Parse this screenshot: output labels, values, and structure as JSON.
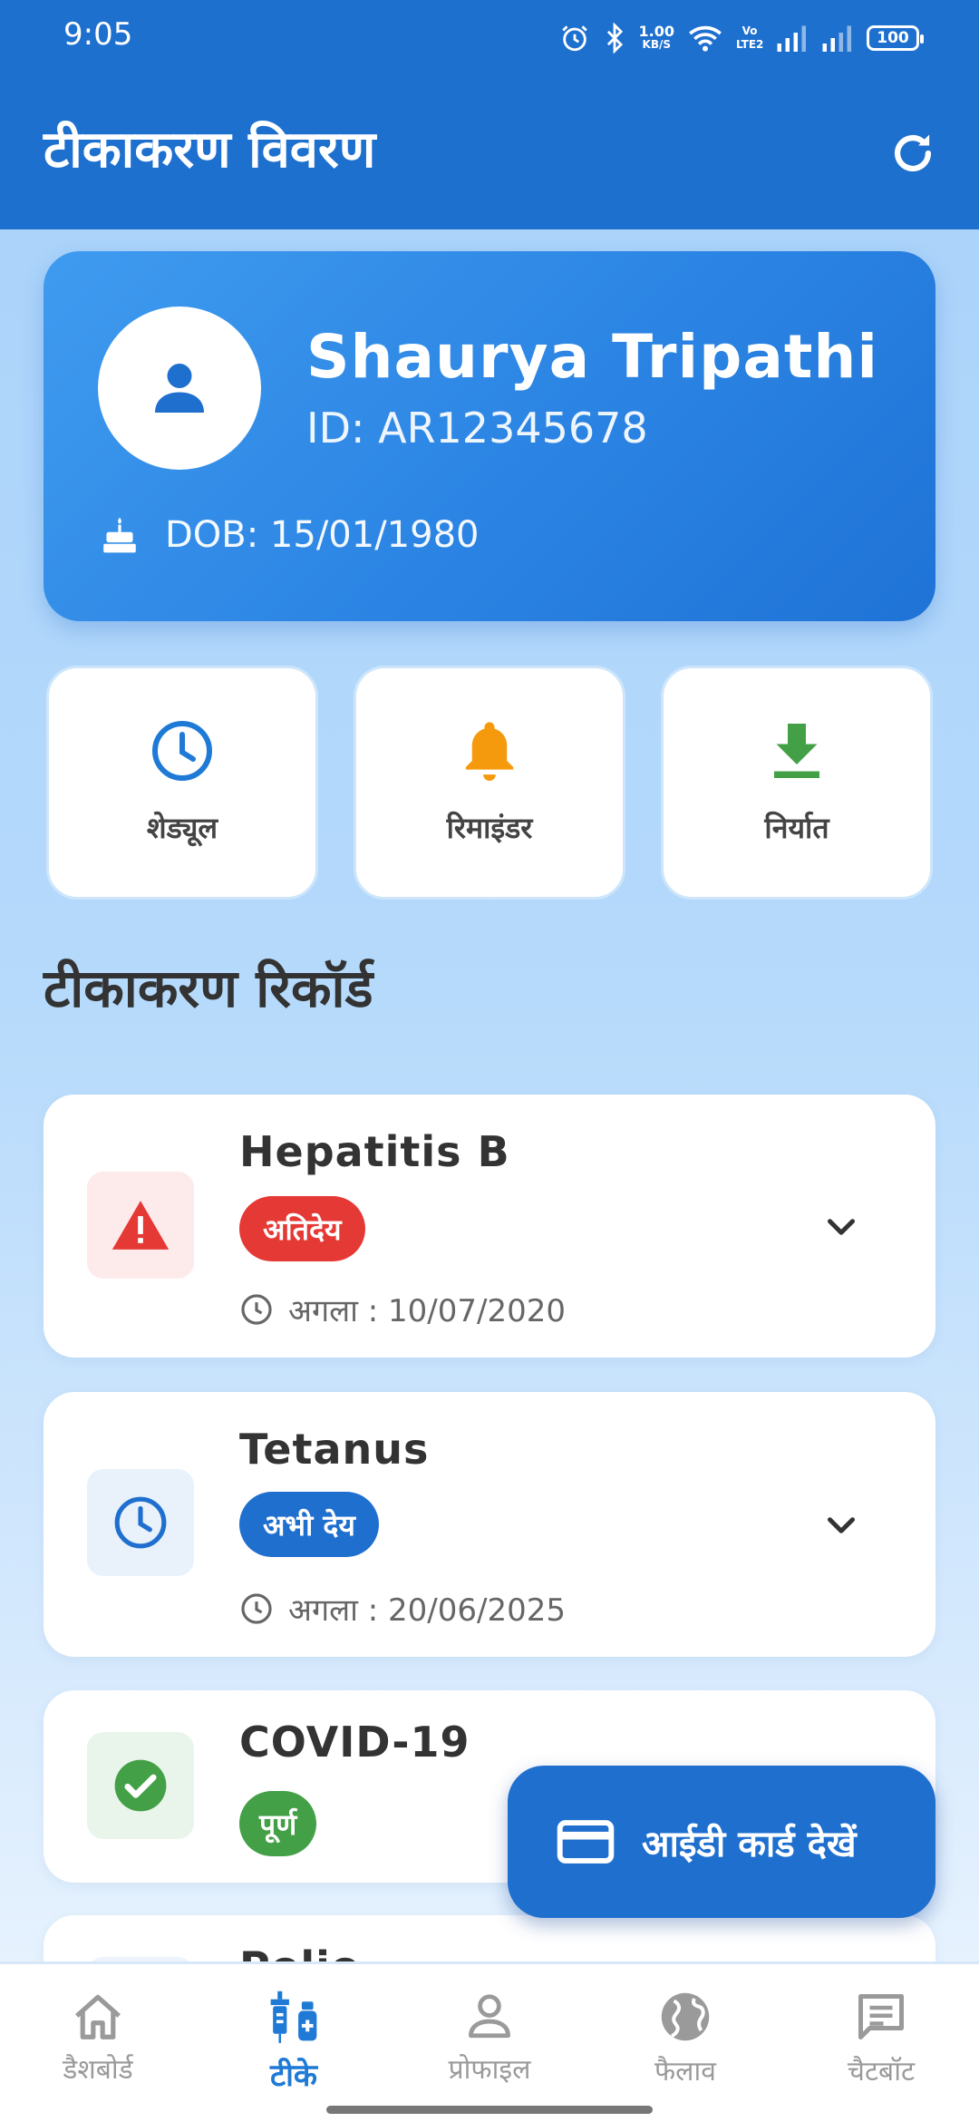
{
  "status_bar": {
    "time": "9:05",
    "network_speed_value": "1.00",
    "network_speed_unit": "KB/S",
    "volte_label": "Vo LTE2",
    "battery": "100"
  },
  "header": {
    "title": "टीकाकरण विवरण",
    "refresh_icon": "refresh-icon"
  },
  "profile": {
    "name": "Shaurya Tripathi",
    "id_text": "ID: AR12345678",
    "dob_text": "DOB: 15/01/1980"
  },
  "actions": [
    {
      "label": "शेड्यूल",
      "icon": "clock-icon",
      "color": "#1f7ad6"
    },
    {
      "label": "रिमाइंडर",
      "icon": "bell-icon",
      "color": "#f59a0c"
    },
    {
      "label": "निर्यात",
      "icon": "download-icon",
      "color": "#43a047"
    }
  ],
  "section_title": "टीकाकरण रिकॉर्ड",
  "vaccines": [
    {
      "name": "Hepatitis B",
      "status": "अतिदेय",
      "status_color": "#e53935",
      "next": "अगला : 10/07/2020",
      "icon": "warning-icon"
    },
    {
      "name": "Tetanus",
      "status": "अभी देय",
      "status_color": "#1f6fcf",
      "next": "अगला : 20/06/2025",
      "icon": "clock-icon"
    },
    {
      "name": "COVID-19",
      "status": "पूर्ण",
      "status_color": "#43a047",
      "icon": "check-circle-icon"
    },
    {
      "name": "Polio"
    }
  ],
  "fab": {
    "label": "आईडी कार्ड देखें",
    "icon": "card-icon"
  },
  "bottom_nav": [
    {
      "label": "डैशबोर्ड",
      "icon": "home-icon",
      "active": false
    },
    {
      "label": "टीके",
      "icon": "vaccine-icon",
      "active": true
    },
    {
      "label": "प्रोफाइल",
      "icon": "person-icon",
      "active": false
    },
    {
      "label": "फैलाव",
      "icon": "globe-icon",
      "active": false
    },
    {
      "label": "चैटबॉट",
      "icon": "chat-icon",
      "active": false
    }
  ]
}
